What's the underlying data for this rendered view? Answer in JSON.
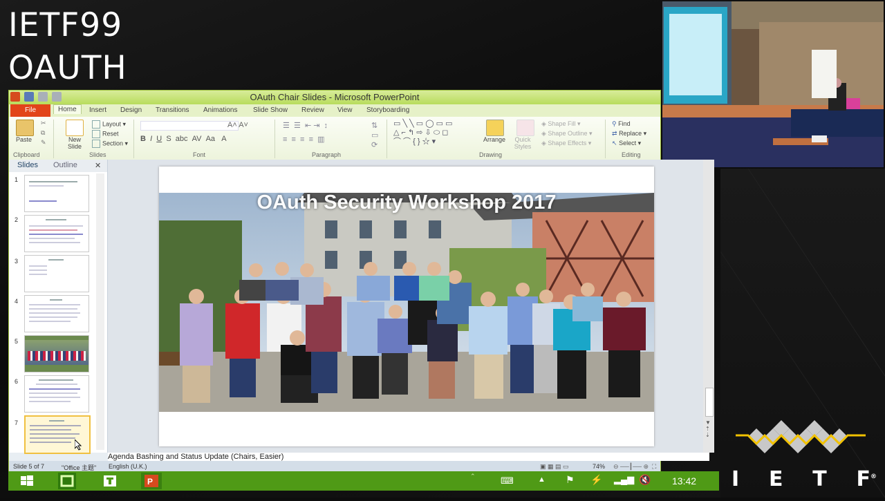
{
  "stream": {
    "line1": "IETF99",
    "line2": "OAUTH"
  },
  "ppt": {
    "window_title": "OAuth Chair Slides - Microsoft PowerPoint",
    "tabs": [
      "File",
      "Home",
      "Insert",
      "Design",
      "Transitions",
      "Animations",
      "Slide Show",
      "Review",
      "View",
      "Storyboarding"
    ],
    "ribbon": {
      "paste": "Paste",
      "new_slide": "New Slide",
      "layout": "Layout",
      "reset": "Reset",
      "section": "Section",
      "arrange": "Arrange",
      "quick_styles": "Quick Styles",
      "shape_fill": "Shape Fill",
      "shape_outline": "Shape Outline",
      "shape_effects": "Shape Effects",
      "find": "Find",
      "replace": "Replace",
      "select": "Select",
      "groups": [
        "Clipboard",
        "Slides",
        "Font",
        "Paragraph",
        "Drawing",
        "Editing"
      ]
    },
    "pane_tabs": {
      "slides": "Slides",
      "outline": "Outline"
    },
    "slide_numbers": [
      "1",
      "2",
      "3",
      "4",
      "5",
      "6",
      "7"
    ],
    "slide": {
      "title": "OAuth Security Workshop 2017"
    },
    "notes": "Agenda Bashing and Status Update (Chairs, Easier)",
    "status": {
      "slide": "Slide 5 of 7",
      "theme": "\"Office 主题\"",
      "language": "English (U.K.)",
      "zoom": "74%"
    }
  },
  "taskbar": {
    "clock": "13:42"
  },
  "logo": {
    "letters": [
      "I",
      "E",
      "T",
      "F"
    ],
    "mark": "®"
  }
}
